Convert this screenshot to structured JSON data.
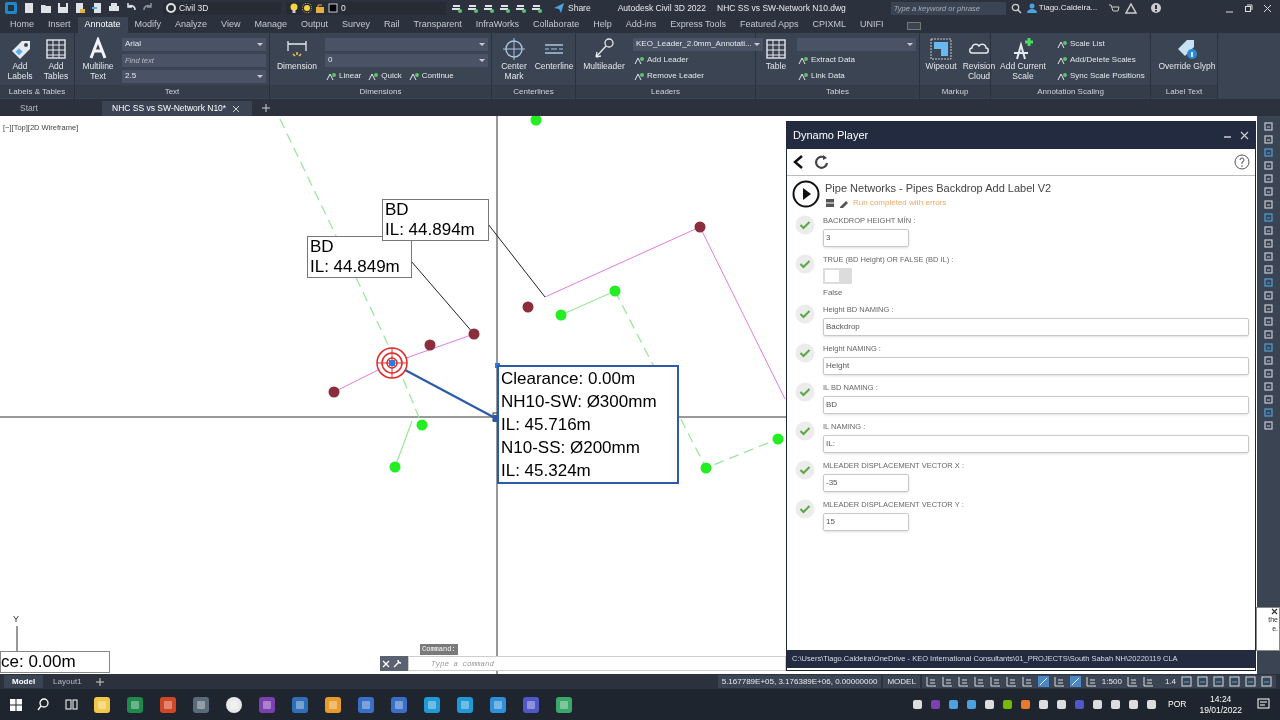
{
  "title_bar": {
    "workspace": "Civil 3D",
    "layer": "0",
    "share": "Share",
    "app_title": "Autodesk Civil 3D 2022",
    "file_name": "NHC SS vs SW-Network N10.dwg",
    "search": {
      "placeholder": "Type a keyword or phrase"
    },
    "user": "Tiago.Caldeira..."
  },
  "ribbon_tabs": [
    {
      "label": "Home",
      "selected": false
    },
    {
      "label": "Insert",
      "selected": false
    },
    {
      "label": "Annotate",
      "selected": true
    },
    {
      "label": "Modify",
      "selected": false
    },
    {
      "label": "Analyze",
      "selected": false
    },
    {
      "label": "View",
      "selected": false
    },
    {
      "label": "Manage",
      "selected": false
    },
    {
      "label": "Output",
      "selected": false
    },
    {
      "label": "Survey",
      "selected": false
    },
    {
      "label": "Rail",
      "selected": false
    },
    {
      "label": "Transparent",
      "selected": false
    },
    {
      "label": "InfraWorks",
      "selected": false
    },
    {
      "label": "Collaborate",
      "selected": false
    },
    {
      "label": "Help",
      "selected": false
    },
    {
      "label": "Add-ins",
      "selected": false
    },
    {
      "label": "Express Tools",
      "selected": false
    },
    {
      "label": "Featured Apps",
      "selected": false
    },
    {
      "label": "CPIXML",
      "selected": false
    },
    {
      "label": "UNIFI",
      "selected": false
    }
  ],
  "ribbon_panels": [
    {
      "title": "Labels & Tables",
      "big_tools": [
        "Add Labels",
        "Add Tables"
      ]
    },
    {
      "title": "Text",
      "big_tools": [
        "Multiline Text"
      ],
      "rows": [
        [
          {
            "kind": "combo",
            "value": "Arial"
          }
        ],
        [
          {
            "kind": "field",
            "placeholder": "Find text"
          }
        ],
        [
          {
            "kind": "combo",
            "value": "2.5"
          }
        ]
      ]
    },
    {
      "title": "Dimensions",
      "big_tools": [
        "Dimension"
      ],
      "rows": [
        [
          {
            "kind": "combo"
          }
        ],
        [
          {
            "kind": "combo",
            "value": "0"
          }
        ],
        [
          {
            "kind": "tool",
            "label": "Linear"
          },
          {
            "kind": "tool",
            "label": "Quick"
          },
          {
            "kind": "tool",
            "label": "Continue"
          }
        ]
      ]
    },
    {
      "title": "Centerlines",
      "big_tools": [
        "Center Mark",
        "Centerline"
      ]
    },
    {
      "title": "Leaders",
      "big_tools": [
        "Multileader"
      ],
      "rows": [
        [
          {
            "kind": "combo",
            "value": "KEO_Leader_2.0mm_Annotati..."
          }
        ],
        [
          {
            "kind": "tool",
            "label": "Add Leader"
          }
        ],
        [
          {
            "kind": "tool",
            "label": "Remove Leader"
          }
        ]
      ]
    },
    {
      "title": "Tables",
      "big_tools": [
        "Table"
      ],
      "rows": [
        [
          {
            "kind": "combo"
          }
        ],
        [
          {
            "kind": "tool",
            "label": "Extract Data"
          }
        ],
        [
          {
            "kind": "tool",
            "label": "Link Data"
          }
        ]
      ]
    },
    {
      "title": "Markup",
      "big_tools": [
        "Wipeout",
        "Revision Cloud"
      ]
    },
    {
      "title": "Annotation Scaling",
      "big_tools": [
        "Add Current Scale"
      ],
      "rows": [
        [
          {
            "kind": "tool",
            "label": "Scale List"
          }
        ],
        [
          {
            "kind": "tool",
            "label": "Add/Delete Scales"
          }
        ],
        [
          {
            "kind": "tool",
            "label": "Sync Scale Positions"
          }
        ]
      ]
    },
    {
      "title": "Label Text",
      "big_tools": [
        "Override Glyph"
      ]
    }
  ],
  "file_tabs": [
    {
      "label": "Start",
      "selected": false
    },
    {
      "label": "NHC SS vs SW-Network N10*",
      "selected": true
    }
  ],
  "drawing": {
    "viewport_label": "[−][Top][2D Wireframe]",
    "labels": [
      {
        "selected": false,
        "lines": [
          "BD",
          "IL: 44.894m"
        ]
      },
      {
        "selected": false,
        "lines": [
          "BD",
          "IL: 44.849m"
        ]
      },
      {
        "selected": true,
        "lines": [
          "Clearance: 0.00m",
          "NH10-SW: Ø300mm",
          "IL: 45.716m",
          "N10-SS: Ø200mm",
          "IL: 45.324m"
        ]
      }
    ],
    "cut_label": "ce: 0.00m",
    "axis": "Y"
  },
  "command_line": {
    "prompt": "Command:",
    "placeholder": "Type a command"
  },
  "dynamo": {
    "title": "Dynamo Player",
    "script": "Pipe Networks - Pipes Backdrop Add Label V2",
    "status": "Run completed with errors",
    "inputs": [
      {
        "kind": "number",
        "label": "BACKDROP HEIGHT MÍN :",
        "value": "3"
      },
      {
        "kind": "toggle",
        "label": "TRUE (BD Height) OR FALSE (BD IL) :",
        "on": false,
        "caption": "False"
      },
      {
        "kind": "text",
        "label": "Height BD NAMING :",
        "value": "Backdrop"
      },
      {
        "kind": "text",
        "label": "Height NAMING :",
        "value": "Height"
      },
      {
        "kind": "text",
        "label": "IL BD NAMING :",
        "value": "BD"
      },
      {
        "kind": "text",
        "label": "IL NAMING :",
        "value": "IL:"
      },
      {
        "kind": "number",
        "label": "MLEADER DISPLACEMENT VECTOR X :",
        "value": "-35"
      },
      {
        "kind": "number",
        "label": "MLEADER DISPLACEMENT VECTOR Y :",
        "value": "15"
      }
    ],
    "path": "C:\\Users\\Tiago.Caldeira\\OneDrive - KEO International Consultants\\01_PROJECTS\\South Sabah NH\\20220119 CLA"
  },
  "tooltip": {
    "lines": [
      "the",
      "e."
    ]
  },
  "layout_tabs": [
    {
      "label": "Model",
      "selected": true
    },
    {
      "label": "Layout1",
      "selected": false
    }
  ],
  "status_bar": {
    "coordinates": "5.167789E+05, 3.176389E+06, 0.00000000",
    "space": "MODEL",
    "scale": "1:500",
    "annotation_scale": "1.4"
  },
  "taskbar": {
    "language": "POR",
    "time": "14:24",
    "date": "19/01/2022"
  }
}
